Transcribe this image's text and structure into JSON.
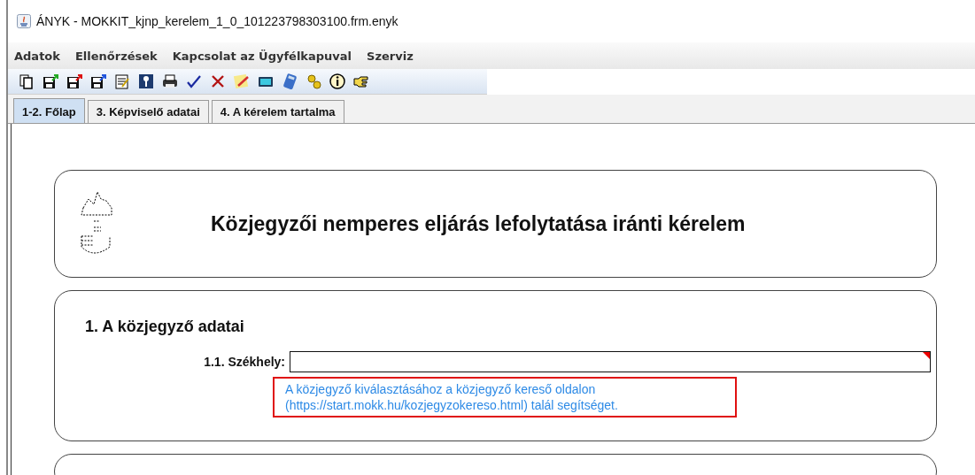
{
  "window": {
    "title": "ÁNYK - MOKKIT_kjnp_kerelem_1_0_101223798303100.frm.enyk"
  },
  "menu": [
    "Adatok",
    "Ellenőrzések",
    "Kapcsolat az Ügyfélkapuval",
    "Szerviz"
  ],
  "tabs": [
    {
      "label": "1-2. Főlap",
      "selected": true
    },
    {
      "label": "3. Képviselő adatai",
      "selected": false
    },
    {
      "label": "4. A kérelem tartalma",
      "selected": false
    }
  ],
  "header": {
    "title": "Közjegyzői nemperes eljárás lefolytatása iránti kérelem"
  },
  "section": {
    "title": "1. A közjegyző adatai",
    "field_label": "1.1. Székhely:",
    "help_lines": [
      "A közjegyző kiválasztásához a közjegyző kereső oldalon",
      "(https://start.mokk.hu/kozjegyzokereso.html) talál segítséget."
    ]
  }
}
